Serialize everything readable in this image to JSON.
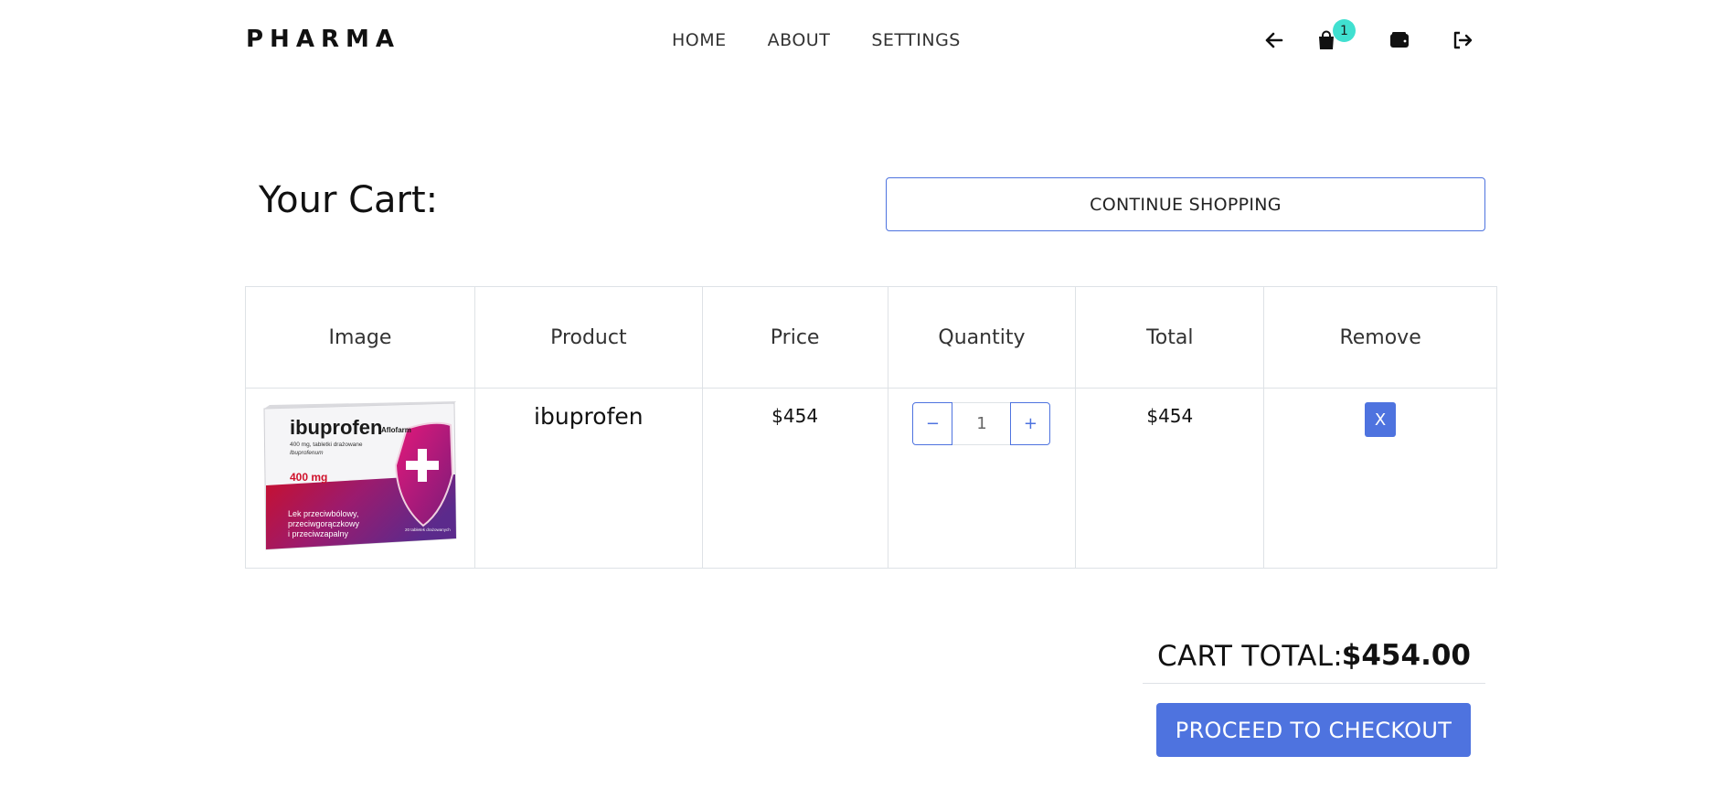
{
  "brand": {
    "logo": "PHARMA"
  },
  "nav": {
    "home": "HOME",
    "about": "ABOUT",
    "settings": "SETTINGS"
  },
  "header_icons": {
    "back": "arrow-left-icon",
    "cart": "shopping-bag-icon",
    "cart_count": "1",
    "wallet": "wallet-icon",
    "logout": "sign-out-icon"
  },
  "cart": {
    "title": "Your Cart:",
    "continue_label": "CONTINUE SHOPPING",
    "columns": [
      "Image",
      "Product",
      "Price",
      "Quantity",
      "Total",
      "Remove"
    ],
    "items": [
      {
        "product": "ibuprofen",
        "price": "$454",
        "quantity": "1",
        "total": "$454",
        "remove_label": "X",
        "qty_minus": "−",
        "qty_plus": "+",
        "image": {
          "brand": "ibuprofen",
          "maker": "Aflofarm",
          "subtitle": "400 mg, tabletki drażowane",
          "latin": "Ibuprofenum",
          "dose": "400 mg",
          "desc_1": "Lek przeciwbólowy,",
          "desc_2": "przeciwgorączkowy",
          "desc_3": "i przeciwzapalny",
          "pack": "20 tabletek drażowanych"
        }
      }
    ],
    "total_label": "CART TOTAL:",
    "total_value": "$454.00",
    "checkout_label": "PROCEED TO CHECKOUT"
  },
  "colors": {
    "accent": "#4e73df",
    "badge": "#40e0d0",
    "border": "#dee2e6"
  }
}
